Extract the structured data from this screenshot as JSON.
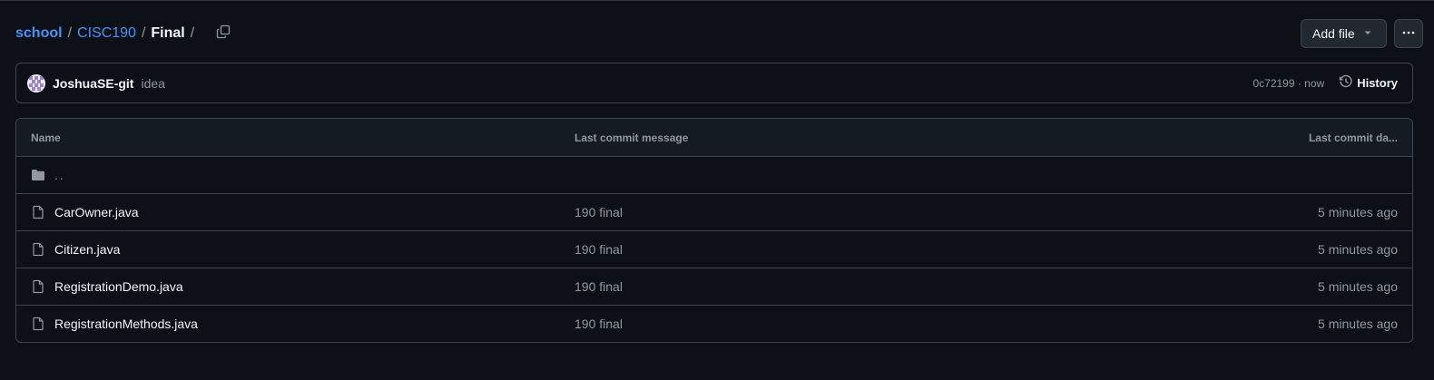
{
  "breadcrumb": {
    "repo": "school",
    "sep1": "/",
    "folder": "CISC190",
    "sep2": "/",
    "current": "Final",
    "sep3": "/"
  },
  "actions": {
    "add_file_label": "Add file",
    "more_label": "···"
  },
  "commit": {
    "author": "JoshuaSE-git",
    "message": "idea",
    "sha_time": "0c72199 · now",
    "history_label": "History"
  },
  "table": {
    "headers": {
      "name": "Name",
      "message": "Last commit message",
      "date": "Last commit da..."
    },
    "parent": "..",
    "files": [
      {
        "name": "CarOwner.java",
        "message": "190 final",
        "date": "5 minutes ago"
      },
      {
        "name": "Citizen.java",
        "message": "190 final",
        "date": "5 minutes ago"
      },
      {
        "name": "RegistrationDemo.java",
        "message": "190 final",
        "date": "5 minutes ago"
      },
      {
        "name": "RegistrationMethods.java",
        "message": "190 final",
        "date": "5 minutes ago"
      }
    ]
  },
  "icons": {
    "copy": "copy-icon",
    "caret": "triangle-down-icon",
    "history": "history-icon",
    "folder": "folder-icon",
    "file": "file-icon"
  },
  "colors": {
    "background": "#0d1117",
    "link": "#4493f8",
    "border": "#3d444d",
    "muted": "#9198a1",
    "header_bg": "#151b23"
  }
}
